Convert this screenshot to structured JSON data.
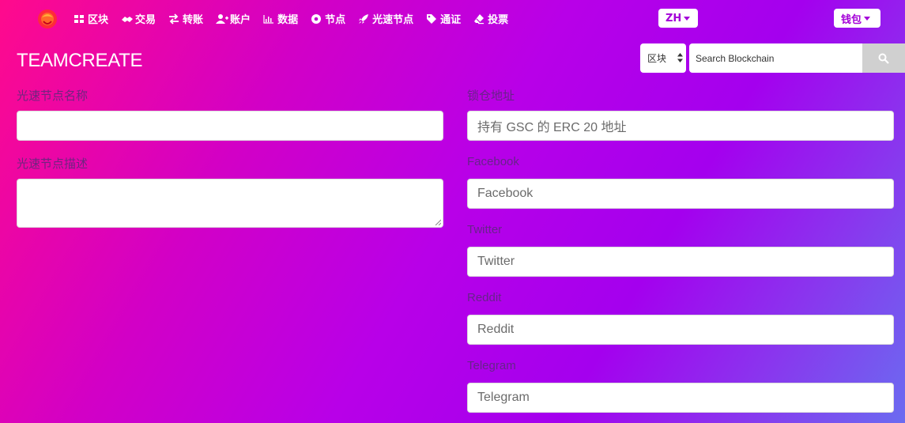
{
  "nav": {
    "items": [
      {
        "label": "区块",
        "icon": "grid-icon"
      },
      {
        "label": "交易",
        "icon": "handshake-icon"
      },
      {
        "label": "转账",
        "icon": "transfer-arrows-icon"
      },
      {
        "label": "账户",
        "icon": "user-plus-icon"
      },
      {
        "label": "数据",
        "icon": "bar-chart-icon"
      },
      {
        "label": "节点",
        "icon": "dot-circle-icon"
      },
      {
        "label": "光速节点",
        "icon": "rocket-icon"
      },
      {
        "label": "通证",
        "icon": "tag-icon"
      },
      {
        "label": "投票",
        "icon": "eraser-icon"
      }
    ],
    "language": "ZH",
    "wallet": "钱包"
  },
  "header": {
    "title": "TEAMCREATE",
    "search_scope": "区块",
    "search_placeholder": "Search Blockchain"
  },
  "form": {
    "left": {
      "name_label": "光速节点名称",
      "name_value": "",
      "desc_label": "光速节点描述",
      "desc_value": ""
    },
    "right": {
      "address_label": "锁仓地址",
      "address_placeholder": "持有 GSC 的 ERC 20 地址",
      "facebook_label": "Facebook",
      "facebook_placeholder": "Facebook",
      "twitter_label": "Twitter",
      "twitter_placeholder": "Twitter",
      "reddit_label": "Reddit",
      "reddit_placeholder": "Reddit",
      "telegram_label": "Telegram",
      "telegram_placeholder": "Telegram"
    }
  },
  "colors": {
    "accent": "#a400d8",
    "gradient_start": "#ff0a8c",
    "gradient_mid": "#b800e8",
    "gradient_end": "#6b6bf0"
  }
}
